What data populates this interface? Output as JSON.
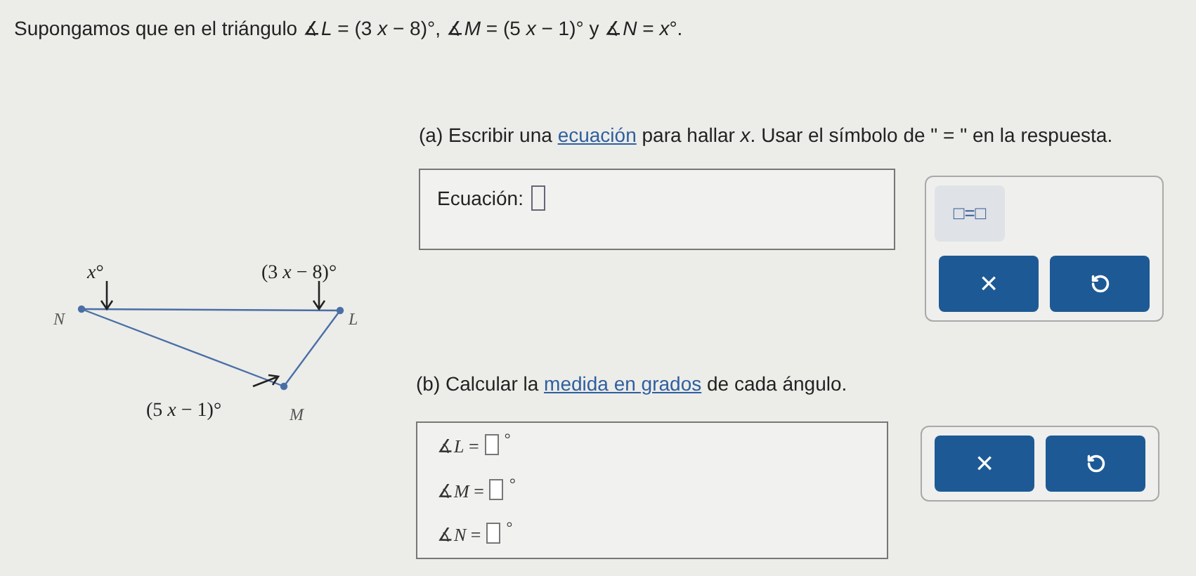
{
  "intro": "Supongamos que en el triángulo ∡*L* = (3 *x* − 8)°, ∡*M* = (5 *x* − 1)° y ∡*N* = *x*°.",
  "part_a": {
    "prefix": "(a) Escribir una ",
    "link": "ecuación",
    "suffix": " para hallar *x*. Usar el símbolo de \" = \" en la respuesta."
  },
  "equation": {
    "label": "Ecuación:"
  },
  "keypad_a": {
    "template": "□=□",
    "clear": "×"
  },
  "diagram": {
    "labels": [
      {
        "kind": "angle",
        "text": "*x*°"
      },
      {
        "kind": "angle",
        "text": "(3 *x* − 8)°"
      },
      {
        "kind": "vertex",
        "text": "N"
      },
      {
        "kind": "vertex",
        "text": "L"
      },
      {
        "kind": "angle",
        "text": "(5 *x* − 1)°"
      },
      {
        "kind": "vertex",
        "text": "M"
      }
    ]
  },
  "part_b": {
    "prefix": "(b) Calcular la ",
    "link": "medida en grados",
    "suffix": " de cada ángulo."
  },
  "angles": [
    {
      "label": "∡*L* =",
      "unit": "°"
    },
    {
      "label": "∡*M* =",
      "unit": "°"
    },
    {
      "label": "∡*N* =",
      "unit": "°"
    }
  ],
  "keypad_b": {
    "clear": "×"
  }
}
